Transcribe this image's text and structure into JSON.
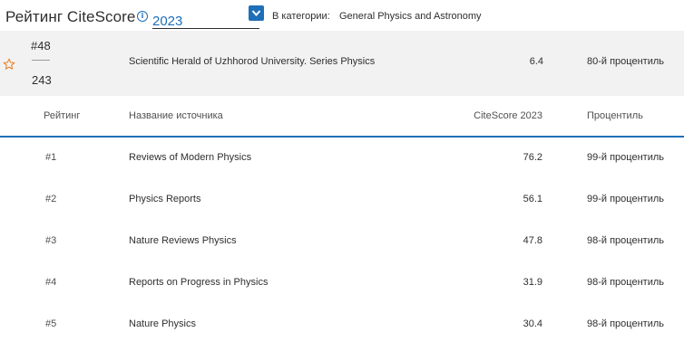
{
  "header": {
    "title": "Рейтинг CiteScore",
    "year": "2023",
    "category_label": "В категории:",
    "category_value": "General Physics and Astronomy"
  },
  "current": {
    "rank": "#48",
    "total": "243",
    "name": "Scientific Herald of Uzhhorod University. Series Physics",
    "score": "6.4",
    "percentile": "80-й процентиль"
  },
  "table": {
    "headers": {
      "rank": "Рейтинг",
      "name": "Название источника",
      "score": "CiteScore 2023",
      "percentile": "Процентиль"
    },
    "rows": [
      {
        "rank": "#1",
        "name": "Reviews of Modern Physics",
        "score": "76.2",
        "percentile": "99-й процентиль"
      },
      {
        "rank": "#2",
        "name": "Physics Reports",
        "score": "56.1",
        "percentile": "99-й процентиль"
      },
      {
        "rank": "#3",
        "name": "Nature Reviews Physics",
        "score": "47.8",
        "percentile": "98-й процентиль"
      },
      {
        "rank": "#4",
        "name": "Reports on Progress in Physics",
        "score": "31.9",
        "percentile": "98-й процентиль"
      },
      {
        "rank": "#5",
        "name": "Nature Physics",
        "score": "30.4",
        "percentile": "98-й процентиль"
      }
    ]
  },
  "colors": {
    "accent": "#1f6fb8",
    "star": "#e8832a",
    "highlight_bg": "#f2f2f2"
  },
  "icons": {
    "info": "info-icon",
    "dropdown": "chevron-down-icon",
    "favorite": "star-icon"
  }
}
